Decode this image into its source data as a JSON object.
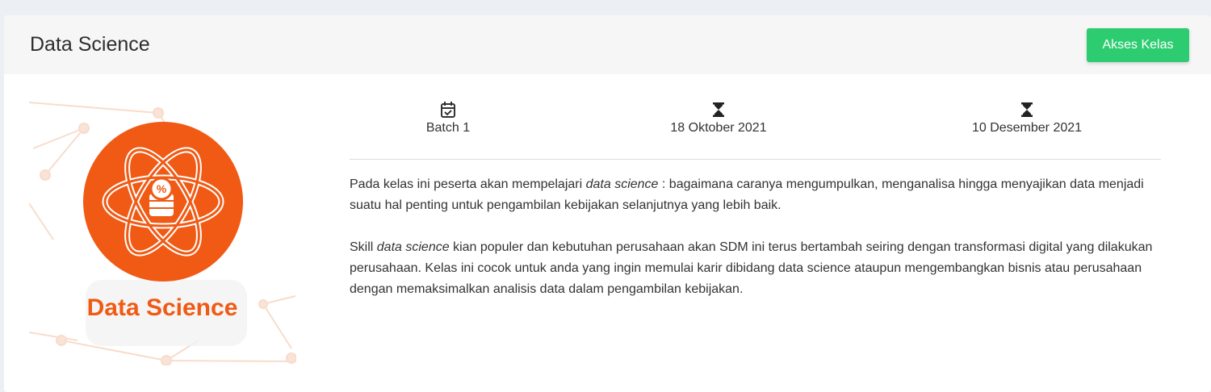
{
  "course": {
    "title": "Data Science",
    "access_button": "Akses Kelas",
    "logo_text": "Data Science",
    "logo_symbol": "%"
  },
  "info": {
    "batch": "Batch 1",
    "start_date": "18 Oktober 2021",
    "end_date": "10 Desember 2021",
    "batch_icon": "calendar-check-icon",
    "start_icon": "hourglass-icon",
    "end_icon": "hourglass-icon"
  },
  "description": {
    "p1_before": "Pada kelas ini peserta akan mempelajari ",
    "p1_em": "data science",
    "p1_after": " : bagaimana caranya mengumpulkan, menganalisa hingga menyajikan data menjadi suatu hal penting untuk pengambilan kebijakan selanjutnya yang lebih baik.",
    "p2_before": "Skill ",
    "p2_em": "data science",
    "p2_after": " kian populer dan kebutuhan perusahaan akan SDM ini terus bertambah seiring dengan transformasi digital yang dilakukan perusahaan. Kelas ini cocok untuk anda yang ingin memulai karir dibidang data science ataupun mengembangkan bisnis atau perusahaan dengan memaksimalkan analisis data dalam pengambilan kebijakan."
  },
  "colors": {
    "accent_green": "#2ecc71",
    "logo_orange": "#f05a14",
    "page_bg": "#ecf0f5",
    "header_bg": "#f6f6f6"
  }
}
